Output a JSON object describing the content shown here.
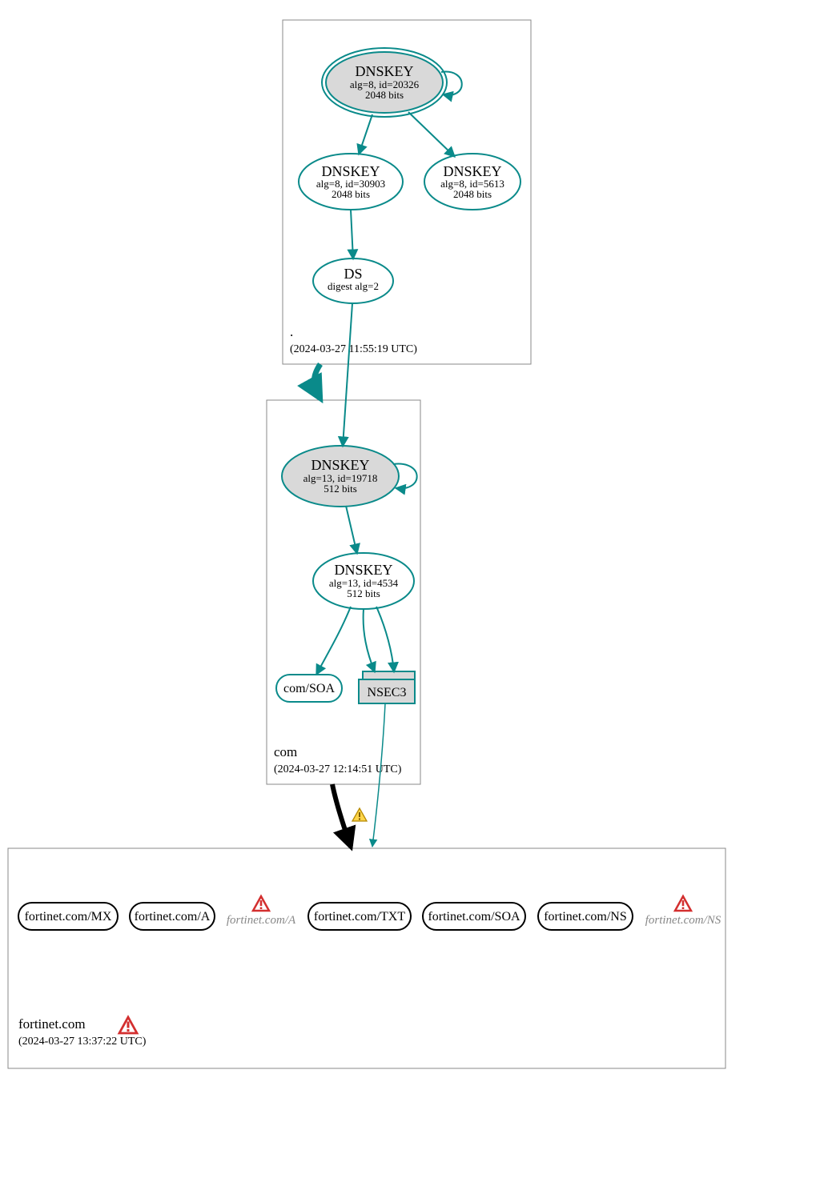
{
  "zones": {
    "root": {
      "name": ".",
      "timestamp": "(2024-03-27 11:55:19 UTC)",
      "keys": {
        "ksk": {
          "title": "DNSKEY",
          "alg": "alg=8, id=20326",
          "bits": "2048 bits"
        },
        "zsk1": {
          "title": "DNSKEY",
          "alg": "alg=8, id=30903",
          "bits": "2048 bits"
        },
        "zsk2": {
          "title": "DNSKEY",
          "alg": "alg=8, id=5613",
          "bits": "2048 bits"
        }
      },
      "ds": {
        "title": "DS",
        "sub": "digest alg=2"
      }
    },
    "com": {
      "name": "com",
      "timestamp": "(2024-03-27 12:14:51 UTC)",
      "keys": {
        "ksk": {
          "title": "DNSKEY",
          "alg": "alg=13, id=19718",
          "bits": "512 bits"
        },
        "zsk": {
          "title": "DNSKEY",
          "alg": "alg=13, id=4534",
          "bits": "512 bits"
        }
      },
      "soa": "com/SOA",
      "nsec3": "NSEC3"
    },
    "fortinet": {
      "name": "fortinet.com",
      "timestamp": "(2024-03-27 13:37:22 UTC)",
      "records": {
        "mx": "fortinet.com/MX",
        "a": "fortinet.com/A",
        "a_err": "fortinet.com/A",
        "txt": "fortinet.com/TXT",
        "soa": "fortinet.com/SOA",
        "ns": "fortinet.com/NS",
        "ns_err": "fortinet.com/NS"
      }
    }
  }
}
